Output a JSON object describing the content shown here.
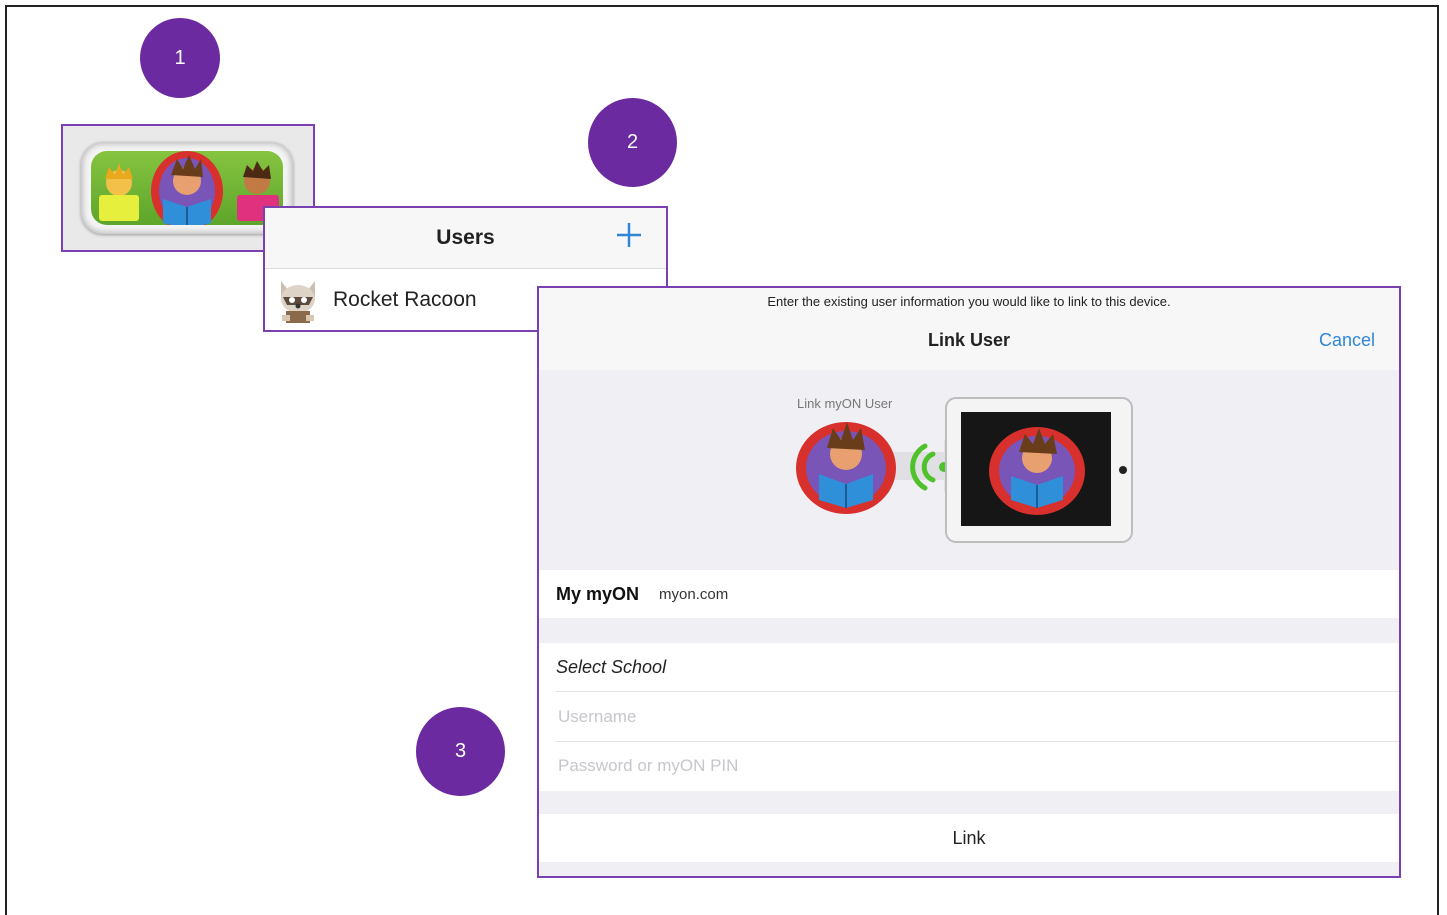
{
  "steps": [
    {
      "number": "1"
    },
    {
      "number": "2"
    },
    {
      "number": "3"
    }
  ],
  "users_panel": {
    "title": "Users",
    "add_icon": "plus-icon",
    "users": [
      {
        "name": "Rocket Racoon",
        "avatar": "raccoon-avatar"
      }
    ]
  },
  "link_user": {
    "instruction": "Enter the existing user information you would like to link to this device.",
    "title": "Link User",
    "cancel_label": "Cancel",
    "illustration_label": "Link myON User",
    "my_myon_label": "My myON",
    "my_myon_domain": "myon.com",
    "select_school": "Select School",
    "username_placeholder": "Username",
    "password_placeholder": "Password or myON PIN",
    "link_label": "Link"
  },
  "colors": {
    "badge": "#6b2aa0",
    "panel_border": "#7a3fb0",
    "ios_blue": "#2f86d6",
    "wifi_green": "#4fc12b"
  }
}
